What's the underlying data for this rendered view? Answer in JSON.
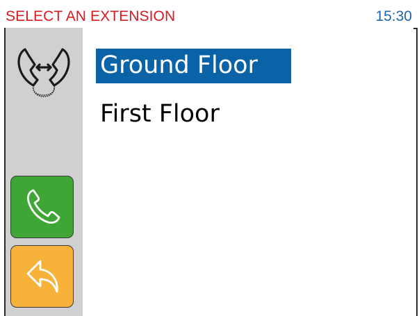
{
  "header": {
    "title": "SELECT AN EXTENSION",
    "time": "15:30"
  },
  "sidebar": {
    "icons": [
      "handset-transfer-icon",
      "phone-icon",
      "back-arrow-icon"
    ]
  },
  "extensions": [
    {
      "label": "Ground Floor",
      "selected": true
    },
    {
      "label": "First Floor",
      "selected": false
    }
  ],
  "colors": {
    "title": "#d71920",
    "time": "#1e66b0",
    "selection": "#0a63a6",
    "call_button": "#3fa535",
    "back_button": "#f7b23b",
    "sidebar": "#d0d0d0"
  }
}
